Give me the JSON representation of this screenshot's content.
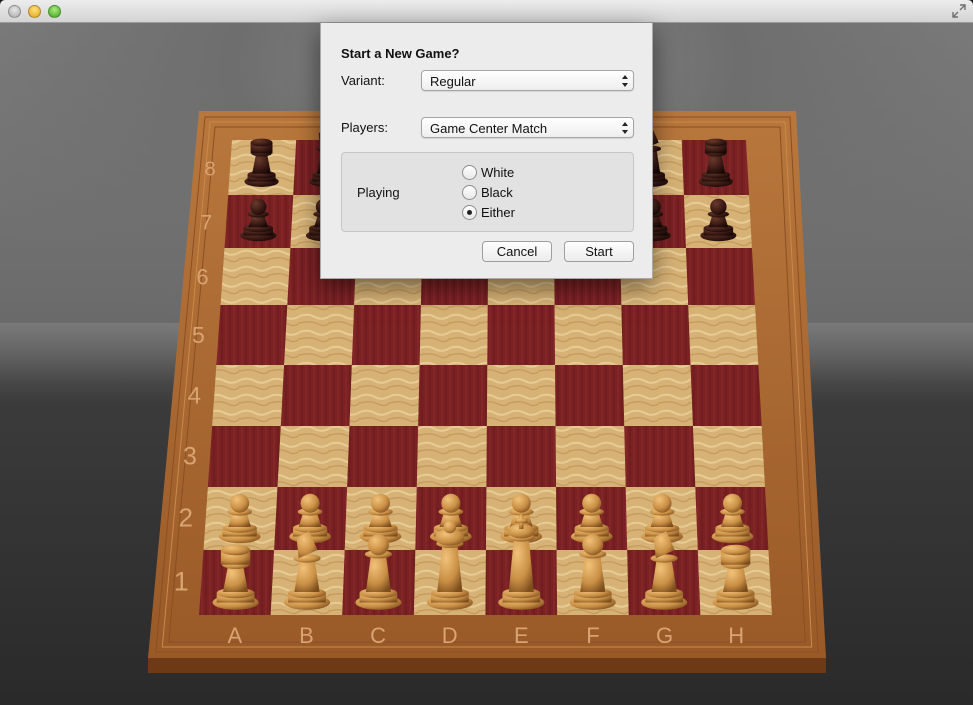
{
  "window": {
    "title": ""
  },
  "board": {
    "files": [
      "A",
      "B",
      "C",
      "D",
      "E",
      "F",
      "G",
      "H"
    ],
    "ranks": [
      "8",
      "7",
      "6",
      "5",
      "4",
      "3",
      "2",
      "1"
    ],
    "colors": {
      "dark_square": "#7a1f22",
      "light_square": "#d9b77a",
      "frame": "#a8652e",
      "white_piece": "#c98f45",
      "black_piece": "#3a1a14"
    }
  },
  "dialog": {
    "title": "Start a New Game?",
    "variant_label": "Variant:",
    "variant_value": "Regular",
    "players_label": "Players:",
    "players_value": "Game Center Match",
    "playing_label": "Playing",
    "options": [
      {
        "label": "White",
        "selected": false
      },
      {
        "label": "Black",
        "selected": false
      },
      {
        "label": "Either",
        "selected": true
      }
    ],
    "cancel_label": "Cancel",
    "start_label": "Start"
  }
}
